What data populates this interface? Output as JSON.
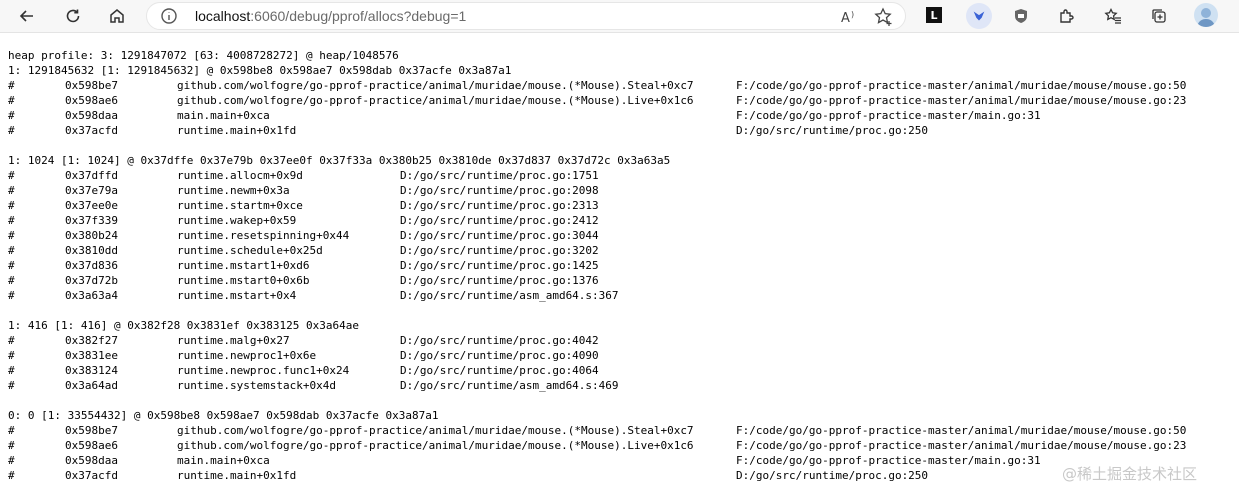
{
  "browser": {
    "url_host": "localhost",
    "url_rest": ":6060/debug/pprof/allocs?debug=1",
    "extension_badge": "L"
  },
  "profile": {
    "header": "heap profile: 3: 1291847072 [63: 4008728272] @ heap/1048576",
    "records": [
      {
        "summary": "1: 1291845632 [1: 1291845632] @ 0x598be8 0x598ae7 0x598dab 0x37acfe 0x3a87a1",
        "col_file": "wide",
        "frames": [
          {
            "hash": "#",
            "addr": "0x598be7",
            "func": "github.com/wolfogre/go-pprof-practice/animal/muridae/mouse.(*Mouse).Steal+0xc7",
            "file": "F:/code/go/go-pprof-practice-master/animal/muridae/mouse/mouse.go:50"
          },
          {
            "hash": "#",
            "addr": "0x598ae6",
            "func": "github.com/wolfogre/go-pprof-practice/animal/muridae/mouse.(*Mouse).Live+0x1c6",
            "file": "F:/code/go/go-pprof-practice-master/animal/muridae/mouse/mouse.go:23"
          },
          {
            "hash": "#",
            "addr": "0x598daa",
            "func": "main.main+0xca",
            "file": "F:/code/go/go-pprof-practice-master/main.go:31"
          },
          {
            "hash": "#",
            "addr": "0x37acfd",
            "func": "runtime.main+0x1fd",
            "file": "D:/go/src/runtime/proc.go:250"
          }
        ]
      },
      {
        "summary": "1: 1024 [1: 1024] @ 0x37dffe 0x37e79b 0x37ee0f 0x37f33a 0x380b25 0x3810de 0x37d837 0x37d72c 0x3a63a5",
        "col_file": "narrow",
        "frames": [
          {
            "hash": "#",
            "addr": "0x37dffd",
            "func": "runtime.allocm+0x9d",
            "file": "D:/go/src/runtime/proc.go:1751"
          },
          {
            "hash": "#",
            "addr": "0x37e79a",
            "func": "runtime.newm+0x3a",
            "file": "D:/go/src/runtime/proc.go:2098"
          },
          {
            "hash": "#",
            "addr": "0x37ee0e",
            "func": "runtime.startm+0xce",
            "file": "D:/go/src/runtime/proc.go:2313"
          },
          {
            "hash": "#",
            "addr": "0x37f339",
            "func": "runtime.wakep+0x59",
            "file": "D:/go/src/runtime/proc.go:2412"
          },
          {
            "hash": "#",
            "addr": "0x380b24",
            "func": "runtime.resetspinning+0x44",
            "file": "D:/go/src/runtime/proc.go:3044"
          },
          {
            "hash": "#",
            "addr": "0x3810dd",
            "func": "runtime.schedule+0x25d",
            "file": "D:/go/src/runtime/proc.go:3202"
          },
          {
            "hash": "#",
            "addr": "0x37d836",
            "func": "runtime.mstart1+0xd6",
            "file": "D:/go/src/runtime/proc.go:1425"
          },
          {
            "hash": "#",
            "addr": "0x37d72b",
            "func": "runtime.mstart0+0x6b",
            "file": "D:/go/src/runtime/proc.go:1376"
          },
          {
            "hash": "#",
            "addr": "0x3a63a4",
            "func": "runtime.mstart+0x4",
            "file": "D:/go/src/runtime/asm_amd64.s:367"
          }
        ]
      },
      {
        "summary": "1: 416 [1: 416] @ 0x382f28 0x3831ef 0x383125 0x3a64ae",
        "col_file": "narrow",
        "frames": [
          {
            "hash": "#",
            "addr": "0x382f27",
            "func": "runtime.malg+0x27",
            "file": "D:/go/src/runtime/proc.go:4042"
          },
          {
            "hash": "#",
            "addr": "0x3831ee",
            "func": "runtime.newproc1+0x6e",
            "file": "D:/go/src/runtime/proc.go:4090"
          },
          {
            "hash": "#",
            "addr": "0x383124",
            "func": "runtime.newproc.func1+0x24",
            "file": "D:/go/src/runtime/proc.go:4064"
          },
          {
            "hash": "#",
            "addr": "0x3a64ad",
            "func": "runtime.systemstack+0x4d",
            "file": "D:/go/src/runtime/asm_amd64.s:469"
          }
        ]
      },
      {
        "summary": "0: 0 [1: 33554432] @ 0x598be8 0x598ae7 0x598dab 0x37acfe 0x3a87a1",
        "col_file": "wide",
        "frames": [
          {
            "hash": "#",
            "addr": "0x598be7",
            "func": "github.com/wolfogre/go-pprof-practice/animal/muridae/mouse.(*Mouse).Steal+0xc7",
            "file": "F:/code/go/go-pprof-practice-master/animal/muridae/mouse/mouse.go:50"
          },
          {
            "hash": "#",
            "addr": "0x598ae6",
            "func": "github.com/wolfogre/go-pprof-practice/animal/muridae/mouse.(*Mouse).Live+0x1c6",
            "file": "F:/code/go/go-pprof-practice-master/animal/muridae/mouse/mouse.go:23"
          },
          {
            "hash": "#",
            "addr": "0x598daa",
            "func": "main.main+0xca",
            "file": "F:/code/go/go-pprof-practice-master/main.go:31"
          },
          {
            "hash": "#",
            "addr": "0x37acfd",
            "func": "runtime.main+0x1fd",
            "file": "D:/go/src/runtime/proc.go:250"
          }
        ]
      }
    ]
  },
  "watermark": "@稀土掘金技术社区"
}
